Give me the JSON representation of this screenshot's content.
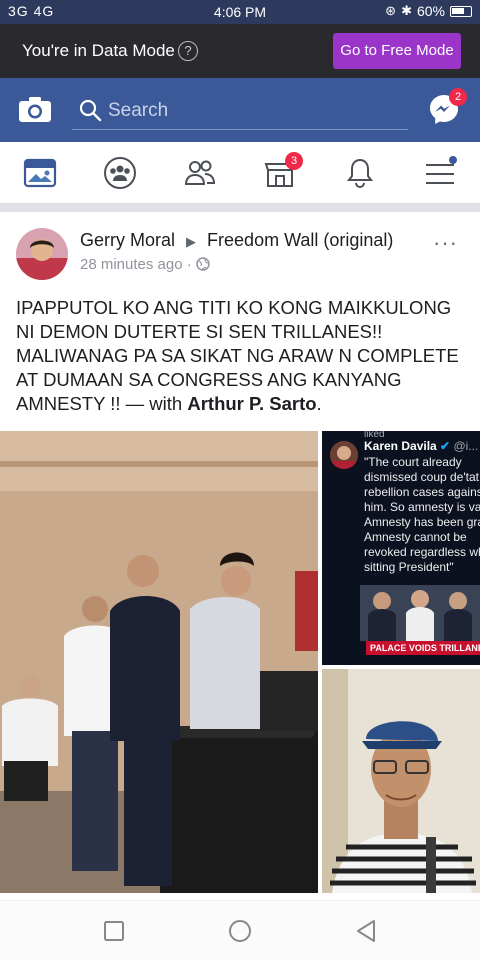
{
  "status_bar": {
    "signal": "3G 4G",
    "time": "4:06 PM",
    "battery": "60%"
  },
  "data_mode": {
    "text": "You're in Data Mode",
    "help": "?",
    "button": "Go to Free Mode",
    "button_color": "#9b35c9"
  },
  "search": {
    "placeholder": "Search",
    "messenger_badge": "2"
  },
  "nav": {
    "marketplace_badge": "3",
    "icons": [
      "news-feed-icon",
      "groups-icon",
      "friends-icon",
      "marketplace-icon",
      "notifications-icon",
      "menu-icon"
    ]
  },
  "post": {
    "author": "Gerry Moral",
    "target": "Freedom Wall (original)",
    "time": "28 minutes ago",
    "more": "···",
    "text_main": "IPAPPUTOL KO ANG TITI KO KONG MAIKKULONG NI DEMON DUTERTE SI SEN TRILLANES!! MALIWANAG PA SA SIKAT NG ARAW N COMPLETE AT DUMAAN SA CONGRESS ANG KANYANG AMNESTY !! — with ",
    "tagged": "Arthur P. Sarto",
    "text_end": "."
  },
  "embed": {
    "liked": "liked",
    "name": "Karen Davila",
    "handle": "@i...",
    "quote_lines": [
      "\"The court already",
      "dismissed coup de'tat",
      "rebellion cases agains",
      "him. So amnesty is val",
      "Amnesty has been gra",
      "Amnesty cannot be",
      "revoked regardless wh",
      "sitting President\""
    ],
    "headline": "PALACE VOIDS TRILLANES A"
  },
  "colors": {
    "facebook_blue": "#3b5998",
    "status_bar": "#2d3a5e",
    "badge_red": "#f02849"
  }
}
